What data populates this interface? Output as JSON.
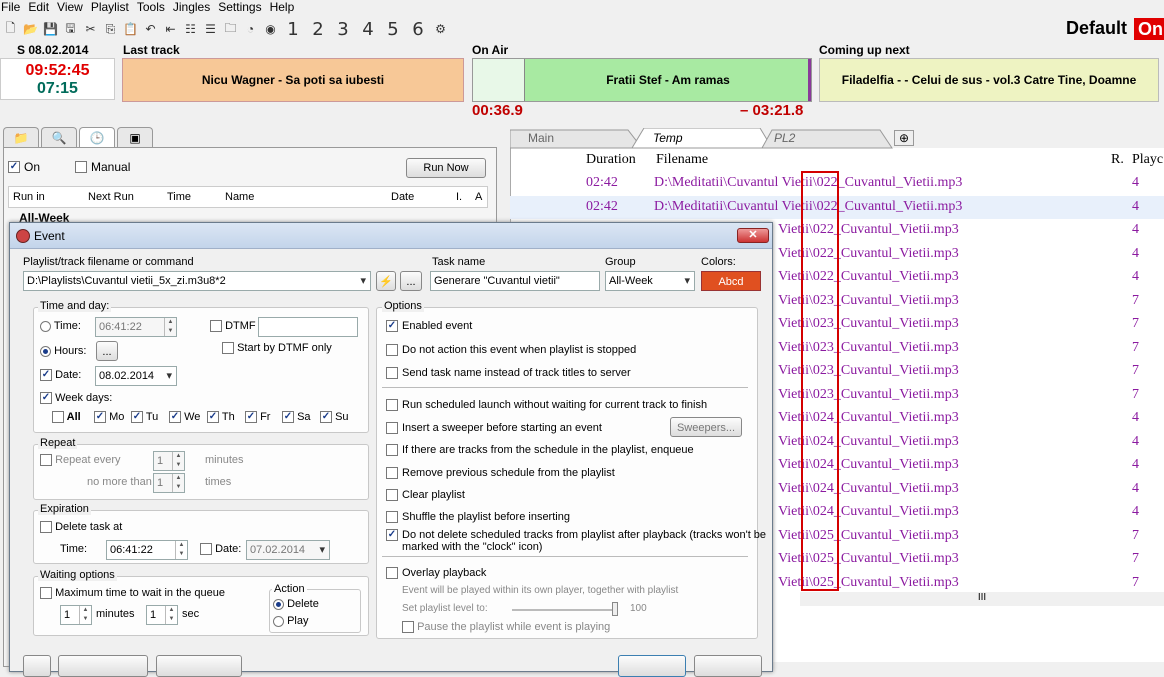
{
  "menu": [
    "File",
    "Edit",
    "View",
    "Playlist",
    "Tools",
    "Jingles",
    "Settings",
    "Help"
  ],
  "toolbar_numbers": [
    "1",
    "2",
    "3",
    "4",
    "5",
    "6"
  ],
  "profile": {
    "name": "Default",
    "badge": "On"
  },
  "status": {
    "date": "S 08.02.2014",
    "clock_time": "09:52:45",
    "clock_sub": "07:15",
    "last_label": "Last track",
    "last_track": "Nicu Wagner - Sa poti sa iubesti",
    "onair_label": "On Air",
    "onair_track": "Fratii Stef - Am ramas",
    "elapsed": "00:36.9",
    "remaining": "– 03:21.8",
    "next_label": "Coming up next",
    "next_track": "Filadelfia - - Celui de sus - vol.3 Catre Tine, Doamne"
  },
  "scheduler": {
    "on_label": "On",
    "manual_label": "Manual",
    "run_now": "Run Now",
    "columns": [
      "Run in",
      "Next Run",
      "Time",
      "Name",
      "Date",
      "I.",
      "A"
    ],
    "group": "All-Week"
  },
  "right": {
    "tabs": [
      "Main",
      "Temp",
      "PL2"
    ],
    "columns": {
      "duration": "Duration",
      "filename": "Filename",
      "r": "R.",
      "played": "Playc"
    },
    "rows": [
      {
        "dur": "02:42",
        "file": "D:\\Meditatii\\Cuvantul Vietii\\022_Cuvantul_Vietii.mp3",
        "r": "4"
      },
      {
        "dur": "02:42",
        "file": "D:\\Meditatii\\Cuvantul Vietii\\022_Cuvantul_Vietii.mp3",
        "r": "4"
      },
      {
        "file": "Vietii\\022_Cuvantul_Vietii.mp3",
        "r": "4"
      },
      {
        "file": "Vietii\\022_Cuvantul_Vietii.mp3",
        "r": "4"
      },
      {
        "file": "Vietii\\022_Cuvantul_Vietii.mp3",
        "r": "4"
      },
      {
        "file": "Vietii\\023_Cuvantul_Vietii.mp3",
        "r": "7"
      },
      {
        "file": "Vietii\\023_Cuvantul_Vietii.mp3",
        "r": "7"
      },
      {
        "file": "Vietii\\023_Cuvantul_Vietii.mp3",
        "r": "7"
      },
      {
        "file": "Vietii\\023_Cuvantul_Vietii.mp3",
        "r": "7"
      },
      {
        "file": "Vietii\\023_Cuvantul_Vietii.mp3",
        "r": "7"
      },
      {
        "file": "Vietii\\024_Cuvantul_Vietii.mp3",
        "r": "4"
      },
      {
        "file": "Vietii\\024_Cuvantul_Vietii.mp3",
        "r": "4"
      },
      {
        "file": "Vietii\\024_Cuvantul_Vietii.mp3",
        "r": "4"
      },
      {
        "file": "Vietii\\024_Cuvantul_Vietii.mp3",
        "r": "4"
      },
      {
        "file": "Vietii\\024_Cuvantul_Vietii.mp3",
        "r": "4"
      },
      {
        "file": "Vietii\\025_Cuvantul_Vietii.mp3",
        "r": "7"
      },
      {
        "file": "Vietii\\025_Cuvantul_Vietii.mp3",
        "r": "7"
      },
      {
        "file": "Vietii\\025_Cuvantul_Vietii.mp3",
        "r": "7"
      }
    ],
    "scroll_mark": "III"
  },
  "dialog": {
    "title": "Event",
    "playlist_label": "Playlist/track filename or command",
    "playlist_value": "D:\\Playlists\\Cuvantul vietii_5x_zi.m3u8*2",
    "browse": "...",
    "task_label": "Task name",
    "task_value": "Generare \"Cuvantul vietii\"",
    "group_label": "Group",
    "group_value": "All-Week",
    "colors_label": "Colors:",
    "colors_value": "Abcd",
    "time_group": "Time and day:",
    "time_label": "Time:",
    "time_value": "06:41:22",
    "dtmf_label": "DTMF",
    "hours_label": "Hours:",
    "hours_btn": "...",
    "start_dtmf": "Start by DTMF only",
    "date_label": "Date:",
    "date_value": "08.02.2014",
    "week_days": "Week days:",
    "days": [
      "All",
      "Mo",
      "Tu",
      "We",
      "Th",
      "Fr",
      "Sa",
      "Su"
    ],
    "repeat_group": "Repeat",
    "repeat_every": "Repeat every",
    "repeat_value": "1",
    "minutes": "minutes",
    "no_more_than": "no more than",
    "times_value": "1",
    "times": "times",
    "exp_group": "Expiration",
    "delete_task": "Delete task at",
    "exp_time_label": "Time:",
    "exp_time": "06:41:22",
    "exp_date_label": "Date:",
    "exp_date": "07.02.2014",
    "wait_group": "Waiting options",
    "max_wait": "Maximum time to wait in the queue",
    "wait_min": "1",
    "minutes2": "minutes",
    "wait_sec": "1",
    "sec": "sec",
    "action_title": "Action",
    "action_delete": "Delete",
    "action_play": "Play",
    "options_group": "Options",
    "options": [
      {
        "label": "Enabled event",
        "on": true
      },
      {
        "label": "Do not action this event when playlist is stopped",
        "on": false
      },
      {
        "label": "Send task name instead of track titles to server",
        "on": false
      },
      {
        "label": "Run scheduled launch without waiting for current track to finish",
        "on": false
      },
      {
        "label": "Insert a sweeper before starting an event",
        "on": false
      },
      {
        "label": "If there are tracks from the schedule in the playlist, enqueue",
        "on": false
      },
      {
        "label": "Remove previous schedule from the playlist",
        "on": false
      },
      {
        "label": "Clear playlist",
        "on": false
      },
      {
        "label": "Shuffle the playlist before inserting",
        "on": false
      },
      {
        "label": "Do not delete scheduled tracks from playlist after playback (tracks won't be",
        "label2": "marked with the \"clock\" icon)",
        "on": true
      },
      {
        "label": "Overlay playback",
        "on": false
      }
    ],
    "sweepers": "Sweepers...",
    "overlay_note": "Event will be played within its own player, together with playlist",
    "set_level": "Set playlist level to:",
    "level": 100,
    "level_text": "100",
    "pause_playlist": "Pause the playlist while event is playing"
  }
}
